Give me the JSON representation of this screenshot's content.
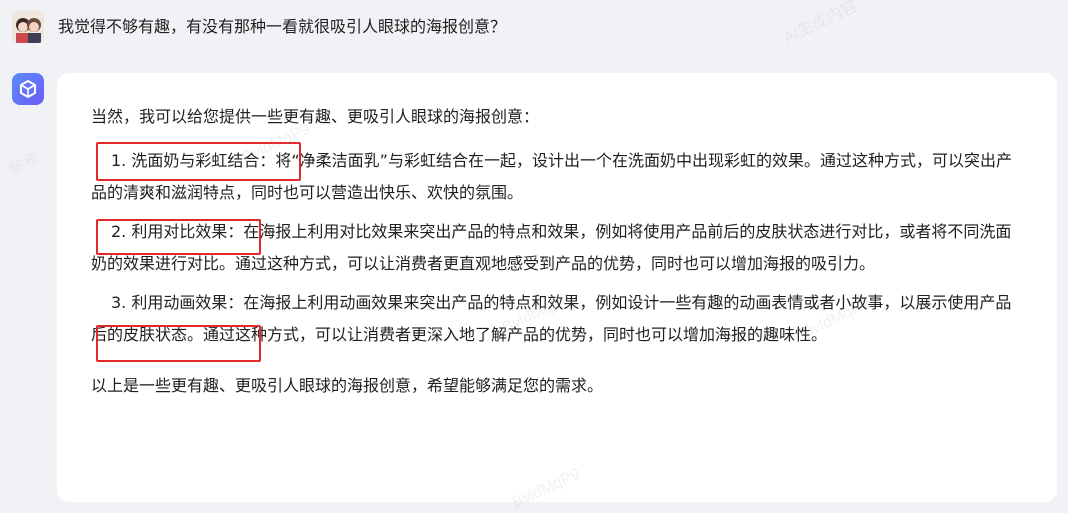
{
  "user_message": {
    "avatar": "user-avatar",
    "text": "我觉得不够有趣，有没有那种一看就很吸引人眼球的海报创意？"
  },
  "assistant_message": {
    "icon": "assistant-cube-icon",
    "intro": "当然，我可以给您提供一些更有趣、更吸引人眼球的海报创意：",
    "items": [
      {
        "title": "1. 洗面奶与彩虹结合：",
        "body": "将“净柔洁面乳”与彩虹结合在一起，设计出一个在洗面奶中出现彩虹的效果。通过这种方式，可以突出产品的清爽和滋润特点，同时也可以营造出快乐、欢快的氛围。"
      },
      {
        "title": "2. 利用对比效果：",
        "body": "在海报上利用对比效果来突出产品的特点和效果，例如将使用产品前后的皮肤状态进行对比，或者将不同洗面奶的效果进行对比。通过这种方式，可以让消费者更直观地感受到产品的优势，同时也可以增加海报的吸引力。"
      },
      {
        "title": "3. 利用动画效果：",
        "body": "在海报上利用动画效果来突出产品的特点和效果，例如设计一些有趣的动画表情或者小故事，以展示使用产品后的皮肤状态。通过这种方式，可以让消费者更深入地了解产品的优势，同时也可以增加海报的趣味性。"
      }
    ],
    "outro": "以上是一些更有趣、更吸引人眼球的海报创意，希望能够满足您的需求。"
  },
  "annotation_color": "#e3272a",
  "watermark_text": "AI生成内容 仅供参考 BvldMqP9"
}
